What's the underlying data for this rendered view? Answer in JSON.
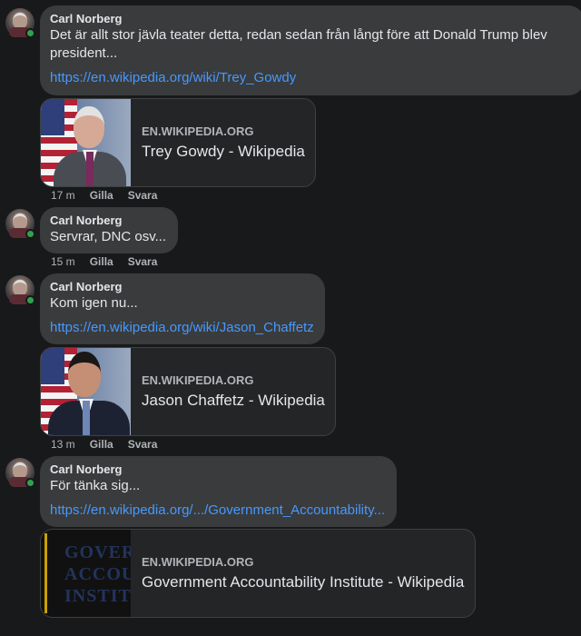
{
  "comments": [
    {
      "author": "Carl Norberg",
      "text": "Det är allt stor jävla teater detta, redan sedan från långt före att Donald Trump blev president...",
      "link": "https://en.wikipedia.org/wiki/Trey_Gowdy",
      "preview": {
        "domain": "EN.WIKIPEDIA.ORG",
        "title": "Trey Gowdy - Wikipedia"
      },
      "time": "17 m",
      "like": "Gilla",
      "reply": "Svara"
    },
    {
      "author": "Carl Norberg",
      "text": "Servrar, DNC osv...",
      "time": "15 m",
      "like": "Gilla",
      "reply": "Svara"
    },
    {
      "author": "Carl Norberg",
      "text": "Kom igen nu...",
      "link": "https://en.wikipedia.org/wiki/Jason_Chaffetz",
      "preview": {
        "domain": "EN.WIKIPEDIA.ORG",
        "title": "Jason Chaffetz - Wikipedia"
      },
      "time": "13 m",
      "like": "Gilla",
      "reply": "Svara"
    },
    {
      "author": "Carl Norberg",
      "text": "För tänka sig...",
      "link": "https://en.wikipedia.org/.../Government_Accountability...",
      "preview": {
        "domain": "EN.WIKIPEDIA.ORG",
        "title": "Government Accountability Institute - Wikipedia"
      }
    }
  ],
  "gai_logo_words": [
    "GOVERN",
    "ACCOUN",
    "INSTITU"
  ],
  "colors": {
    "link": "#4599ff",
    "online": "#31a24c",
    "bubble": "#3a3b3c"
  }
}
